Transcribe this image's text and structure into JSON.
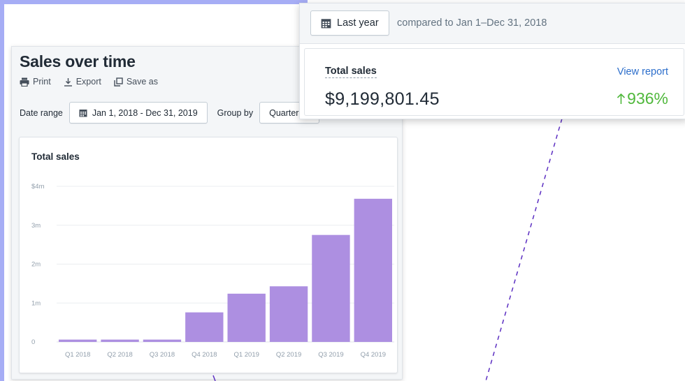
{
  "report": {
    "title": "Sales over time",
    "actions": {
      "print": "Print",
      "export": "Export",
      "save_as": "Save as"
    },
    "filters": {
      "date_range_label": "Date range",
      "date_range_value": "Jan 1, 2018 - Dec 31, 2019",
      "group_by_label": "Group by",
      "group_by_value": "Quarter"
    }
  },
  "chart_data": {
    "type": "bar",
    "title": "Total sales",
    "categories": [
      "Q1 2018",
      "Q2 2018",
      "Q3 2018",
      "Q4 2018",
      "Q1 2019",
      "Q2 2019",
      "Q3 2019",
      "Q4 2019"
    ],
    "values": [
      60000,
      60000,
      60000,
      760000,
      1240000,
      1430000,
      2750000,
      3680000
    ],
    "yticks": [
      {
        "value": 0,
        "label": "0"
      },
      {
        "value": 1000000,
        "label": "1m"
      },
      {
        "value": 2000000,
        "label": "2m"
      },
      {
        "value": 3000000,
        "label": "3m"
      },
      {
        "value": 4000000,
        "label": "$4m"
      }
    ],
    "ylim": [
      0,
      4000000
    ],
    "xlabel": "",
    "ylabel": "",
    "grid": true,
    "bar_color": "#ad8fe1"
  },
  "summary": {
    "period_button": "Last year",
    "compare_text": "compared to Jan 1–Dec 31, 2018",
    "metric_label": "Total sales",
    "metric_value": "$9,199,801.45",
    "view_report": "View report",
    "change": "936%",
    "change_color": "#50b83c"
  },
  "colors": {
    "accent_link": "#2c6ecb",
    "connector": "#5c2fc2",
    "left_strip": "#a6adf5"
  }
}
